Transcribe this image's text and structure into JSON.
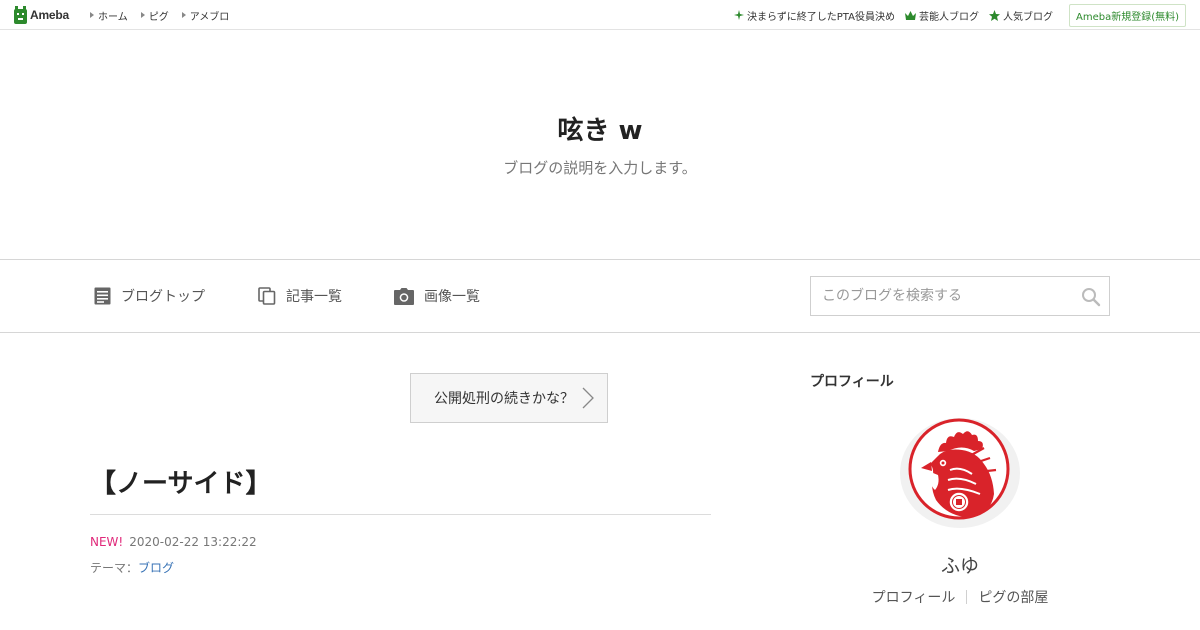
{
  "topbar": {
    "logo": "Ameba",
    "nav": [
      "ホーム",
      "ピグ",
      "アメブロ"
    ],
    "links": [
      {
        "label": "決まらずに終了したPTA役員決め",
        "icon": "sparkle-icon"
      },
      {
        "label": "芸能人ブログ",
        "icon": "crown-icon"
      },
      {
        "label": "人気ブログ",
        "icon": "star-icon"
      }
    ],
    "register": "Ameba新規登録(無料)"
  },
  "blog": {
    "title": "呟き w",
    "description": "ブログの説明を入力します。"
  },
  "blog_nav": {
    "items": [
      {
        "label": "ブログトップ",
        "icon": "document-icon"
      },
      {
        "label": "記事一覧",
        "icon": "copy-icon"
      },
      {
        "label": "画像一覧",
        "icon": "camera-icon"
      }
    ],
    "search_placeholder": "このブログを検索する"
  },
  "article": {
    "prev_link": "公開処刑の続きかな？",
    "title": "【ノーサイド】",
    "new_badge": "NEW!",
    "timestamp": "2020-02-22 13:22:22",
    "theme_label": "テーマ：",
    "theme_value": "ブログ"
  },
  "sidebar": {
    "heading": "プロフィール",
    "name": "ふゆ",
    "links": [
      "プロフィール",
      "ピグの部屋"
    ]
  },
  "colors": {
    "accent_green": "#2d8a2d",
    "new_pink": "#e0297a",
    "link_blue": "#3772b5",
    "avatar_red": "#d9232a"
  }
}
